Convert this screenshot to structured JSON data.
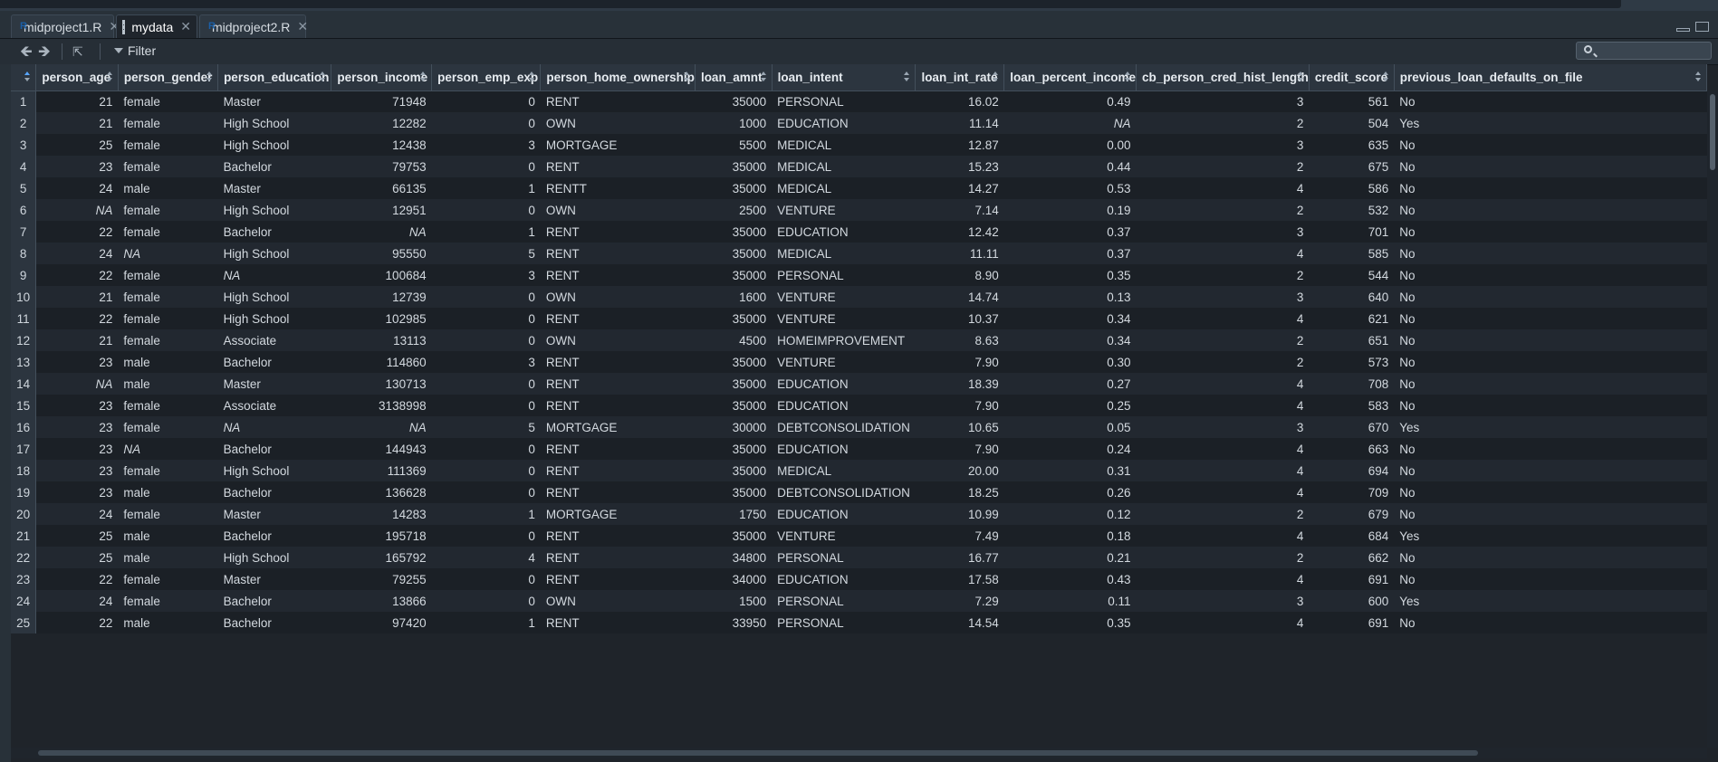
{
  "tabs": [
    {
      "label": "midproject1.R",
      "icon": "r-file-icon"
    },
    {
      "label": "mydata",
      "icon": "data-grid-icon"
    },
    {
      "label": "midproject2.R",
      "icon": "r-file-icon"
    }
  ],
  "toolbar": {
    "filter_label": "Filter",
    "search_placeholder": ""
  },
  "columns": [
    "person_age",
    "person_gender",
    "person_education",
    "person_income",
    "person_emp_exp",
    "person_home_ownership",
    "loan_amnt",
    "loan_intent",
    "loan_int_rate",
    "loan_percent_income",
    "cb_person_cred_hist_length",
    "credit_score",
    "previous_loan_defaults_on_file"
  ],
  "rows": [
    [
      "1",
      "21",
      "female",
      "Master",
      "71948",
      "0",
      "RENT",
      "35000",
      "PERSONAL",
      "16.02",
      "0.49",
      "3",
      "561",
      "No"
    ],
    [
      "2",
      "21",
      "female",
      "High School",
      "12282",
      "0",
      "OWN",
      "1000",
      "EDUCATION",
      "11.14",
      "NA",
      "2",
      "504",
      "Yes"
    ],
    [
      "3",
      "25",
      "female",
      "High School",
      "12438",
      "3",
      "MORTGAGE",
      "5500",
      "MEDICAL",
      "12.87",
      "0.00",
      "3",
      "635",
      "No"
    ],
    [
      "4",
      "23",
      "female",
      "Bachelor",
      "79753",
      "0",
      "RENT",
      "35000",
      "MEDICAL",
      "15.23",
      "0.44",
      "2",
      "675",
      "No"
    ],
    [
      "5",
      "24",
      "male",
      "Master",
      "66135",
      "1",
      "RENTT",
      "35000",
      "MEDICAL",
      "14.27",
      "0.53",
      "4",
      "586",
      "No"
    ],
    [
      "6",
      "NA",
      "female",
      "High School",
      "12951",
      "0",
      "OWN",
      "2500",
      "VENTURE",
      "7.14",
      "0.19",
      "2",
      "532",
      "No"
    ],
    [
      "7",
      "22",
      "female",
      "Bachelor",
      "NA",
      "1",
      "RENT",
      "35000",
      "EDUCATION",
      "12.42",
      "0.37",
      "3",
      "701",
      "No"
    ],
    [
      "8",
      "24",
      "NA",
      "High School",
      "95550",
      "5",
      "RENT",
      "35000",
      "MEDICAL",
      "11.11",
      "0.37",
      "4",
      "585",
      "No"
    ],
    [
      "9",
      "22",
      "female",
      "NA",
      "100684",
      "3",
      "RENT",
      "35000",
      "PERSONAL",
      "8.90",
      "0.35",
      "2",
      "544",
      "No"
    ],
    [
      "10",
      "21",
      "female",
      "High School",
      "12739",
      "0",
      "OWN",
      "1600",
      "VENTURE",
      "14.74",
      "0.13",
      "3",
      "640",
      "No"
    ],
    [
      "11",
      "22",
      "female",
      "High School",
      "102985",
      "0",
      "RENT",
      "35000",
      "VENTURE",
      "10.37",
      "0.34",
      "4",
      "621",
      "No"
    ],
    [
      "12",
      "21",
      "female",
      "Associate",
      "13113",
      "0",
      "OWN",
      "4500",
      "HOMEIMPROVEMENT",
      "8.63",
      "0.34",
      "2",
      "651",
      "No"
    ],
    [
      "13",
      "23",
      "male",
      "Bachelor",
      "114860",
      "3",
      "RENT",
      "35000",
      "VENTURE",
      "7.90",
      "0.30",
      "2",
      "573",
      "No"
    ],
    [
      "14",
      "NA",
      "male",
      "Master",
      "130713",
      "0",
      "RENT",
      "35000",
      "EDUCATION",
      "18.39",
      "0.27",
      "4",
      "708",
      "No"
    ],
    [
      "15",
      "23",
      "female",
      "Associate",
      "3138998",
      "0",
      "RENT",
      "35000",
      "EDUCATION",
      "7.90",
      "0.25",
      "4",
      "583",
      "No"
    ],
    [
      "16",
      "23",
      "female",
      "NA",
      "NA",
      "5",
      "MORTGAGE",
      "30000",
      "DEBTCONSOLIDATION",
      "10.65",
      "0.05",
      "3",
      "670",
      "Yes"
    ],
    [
      "17",
      "23",
      "NA",
      "Bachelor",
      "144943",
      "0",
      "RENT",
      "35000",
      "EDUCATION",
      "7.90",
      "0.24",
      "4",
      "663",
      "No"
    ],
    [
      "18",
      "23",
      "female",
      "High School",
      "111369",
      "0",
      "RENT",
      "35000",
      "MEDICAL",
      "20.00",
      "0.31",
      "4",
      "694",
      "No"
    ],
    [
      "19",
      "23",
      "male",
      "Bachelor",
      "136628",
      "0",
      "RENT",
      "35000",
      "DEBTCONSOLIDATION",
      "18.25",
      "0.26",
      "4",
      "709",
      "No"
    ],
    [
      "20",
      "24",
      "female",
      "Master",
      "14283",
      "1",
      "MORTGAGE",
      "1750",
      "EDUCATION",
      "10.99",
      "0.12",
      "2",
      "679",
      "No"
    ],
    [
      "21",
      "25",
      "male",
      "Bachelor",
      "195718",
      "0",
      "RENT",
      "35000",
      "VENTURE",
      "7.49",
      "0.18",
      "4",
      "684",
      "Yes"
    ],
    [
      "22",
      "25",
      "male",
      "High School",
      "165792",
      "4",
      "RENT",
      "34800",
      "PERSONAL",
      "16.77",
      "0.21",
      "2",
      "662",
      "No"
    ],
    [
      "23",
      "22",
      "female",
      "Master",
      "79255",
      "0",
      "RENT",
      "34000",
      "EDUCATION",
      "17.58",
      "0.43",
      "4",
      "691",
      "No"
    ],
    [
      "24",
      "24",
      "female",
      "Bachelor",
      "13866",
      "0",
      "OWN",
      "1500",
      "PERSONAL",
      "7.29",
      "0.11",
      "3",
      "600",
      "Yes"
    ],
    [
      "25",
      "22",
      "male",
      "Bachelor",
      "97420",
      "1",
      "RENT",
      "33950",
      "PERSONAL",
      "14.54",
      "0.35",
      "4",
      "691",
      "No"
    ]
  ]
}
